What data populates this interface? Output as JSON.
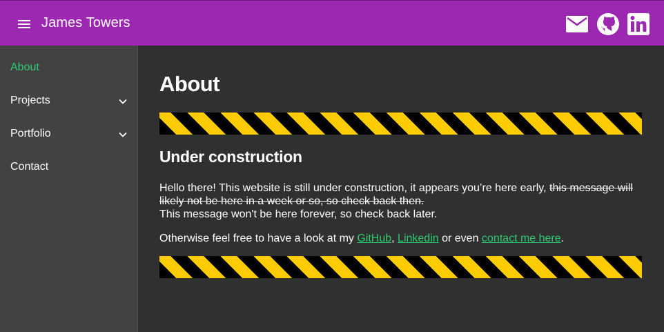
{
  "header": {
    "title": "James Towers",
    "icons": [
      "menu-icon",
      "mail-icon",
      "github-icon",
      "linkedin-icon"
    ]
  },
  "sidebar": {
    "items": [
      {
        "label": "About",
        "active": true
      },
      {
        "label": "Projects",
        "expandable": true
      },
      {
        "label": "Portfolio",
        "expandable": true
      },
      {
        "label": "Contact"
      }
    ]
  },
  "main": {
    "title": "About",
    "subtitle": "Under construction",
    "intro_text": "Hello there! This website is still under construction, it appears you’re here early, ",
    "struck_text": "this message will likely not be here in a week or so, so check back then.",
    "forever_text": "This message won't be here forever, so check back later.",
    "otherwise_prefix": "Otherwise feel free to have a look at my ",
    "github_link": "GitHub",
    "comma": ", ",
    "linkedin_link": "Linkedin",
    "or_even": " or even ",
    "contact_link": "contact me here",
    "period": "."
  },
  "colors": {
    "topbar": "#9c27b0",
    "sidebar": "#424242",
    "background": "#303030",
    "accent": "#2ecc71",
    "stripe_yellow": "#ffcc00",
    "stripe_black": "#000000"
  }
}
